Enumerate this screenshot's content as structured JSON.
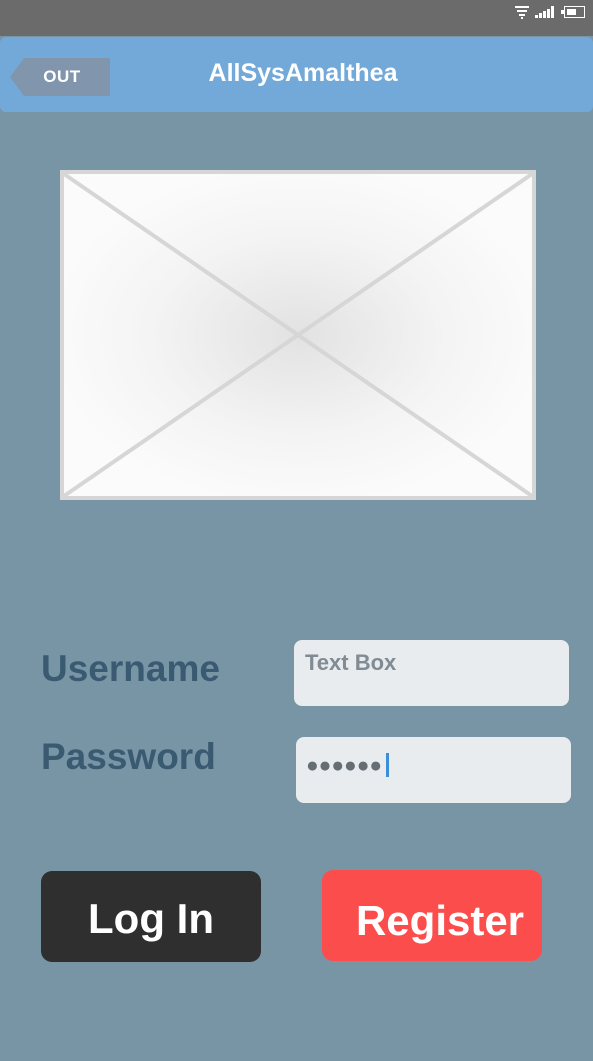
{
  "status_bar": {
    "icons": [
      "wifi-icon",
      "signal-icon",
      "battery-icon"
    ]
  },
  "header": {
    "back_button_label": "OUT",
    "title": "AllSysAmalthea"
  },
  "hero_image": {
    "icon": "image-placeholder-icon"
  },
  "form": {
    "username_label": "Username",
    "username_placeholder": "Text Box",
    "password_label": "Password",
    "password_masked": "●●●●●●"
  },
  "actions": {
    "login_label": "Log In",
    "register_label": "Register"
  },
  "colors": {
    "background": "#7895a6",
    "header": "#72a9d9",
    "status_bar": "#6b6b6b",
    "label_text": "#3a5a72",
    "login_button": "#2f2f2f",
    "register_button": "#fc4d4d",
    "caret": "#3a8fd8"
  }
}
